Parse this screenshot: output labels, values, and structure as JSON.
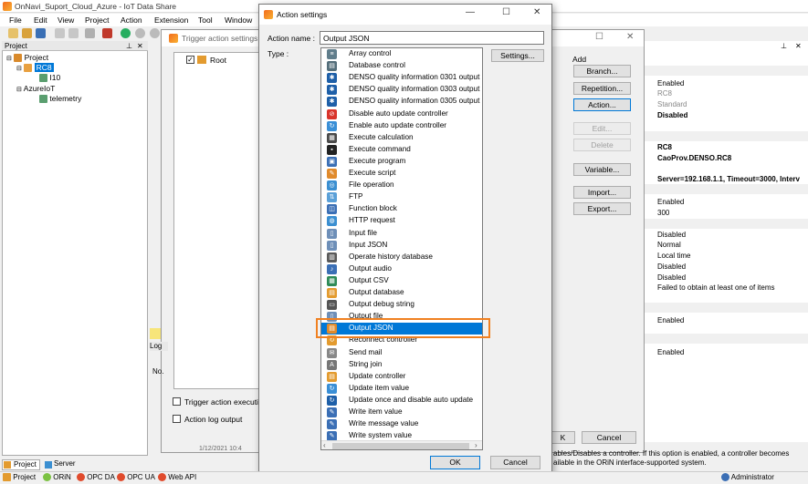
{
  "app": {
    "title": "OnNavi_Suport_Cloud_Azure - IoT Data Share",
    "menu": [
      "File",
      "Edit",
      "View",
      "Project",
      "Action",
      "Extension",
      "Tool",
      "Window"
    ]
  },
  "project_panel": {
    "title": "Project",
    "pin": "⊥",
    "close": "✕",
    "tree": [
      "Project",
      "RC8",
      "I10",
      "AzureIoT",
      "telemetry"
    ]
  },
  "bg_dialog": {
    "title": "Trigger action settings",
    "root_label": "Root",
    "add_label": "Add",
    "buttons": [
      "Branch...",
      "Repetition...",
      "Action...",
      "Edit...",
      "Delete",
      "Variable...",
      "Import...",
      "Export..."
    ],
    "cancel_label": "Cancel",
    "check_trigger": "Trigger action executi",
    "check_log": "Action log output",
    "log_tab": "Log",
    "log_col": "No.",
    "log_row_time": "1/12/2021 10:4"
  },
  "properties": [
    {
      "text": "Enabled",
      "bold": false
    },
    {
      "text": "RC8",
      "bold": false
    },
    {
      "text": "Standard",
      "bold": false
    },
    {
      "text": "Disabled",
      "bold": true
    },
    {
      "text": "RC8",
      "bold": true
    },
    {
      "text": "CaoProv.DENSO.RC8",
      "bold": true
    },
    {
      "text": "Server=192.168.1.1, Timeout=3000, Interv",
      "bold": true
    },
    {
      "text": "Enabled",
      "bold": false
    },
    {
      "text": "300",
      "bold": false
    },
    {
      "text": "Disabled",
      "bold": false
    },
    {
      "text": "Normal",
      "bold": false
    },
    {
      "text": "Local time",
      "bold": false
    },
    {
      "text": "Disabled",
      "bold": false
    },
    {
      "text": "Disabled",
      "bold": false
    },
    {
      "text": "Failed to obtain at least one of items",
      "bold": false
    },
    {
      "text": "Enabled",
      "bold": false
    },
    {
      "text": "Enabled",
      "bold": false
    }
  ],
  "description": {
    "line1": "ables/Disables a controller. If this option is enabled, a controller becomes",
    "line2": "ailable in the ORiN interface-supported system.",
    "k_btn": "K"
  },
  "dialog": {
    "title": "Action settings",
    "action_name_label": "Action name :",
    "action_name_value": "Output JSON",
    "type_label": "Type :",
    "settings_label": "Settings...",
    "ok_label": "OK",
    "cancel_label": "Cancel",
    "types": [
      "Array control",
      "Database control",
      "DENSO quality information 0301 output",
      "DENSO quality information 0303 output",
      "DENSO quality information 0305 output",
      "Disable auto update controller",
      "Enable auto update controller",
      "Execute calculation",
      "Execute command",
      "Execute program",
      "Execute script",
      "File operation",
      "FTP",
      "Function block",
      "HTTP request",
      "Input file",
      "Input JSON",
      "Operate history database",
      "Output audio",
      "Output CSV",
      "Output database",
      "Output debug string",
      "Output file",
      "Output JSON",
      "Reconnect controller",
      "Send mail",
      "String join",
      "Update controller",
      "Update item value",
      "Update once and disable auto update",
      "Write item value",
      "Write message value",
      "Write system value"
    ],
    "selected_index": 23
  },
  "bottom_tabs": [
    "Project",
    "Server"
  ],
  "statusbar": {
    "items": [
      "Project",
      "ORiN",
      "OPC DA",
      "OPC UA",
      "Web API"
    ],
    "user": "Administrator"
  },
  "colors": {
    "accent": "#0078d7",
    "highlight": "#f08020"
  }
}
